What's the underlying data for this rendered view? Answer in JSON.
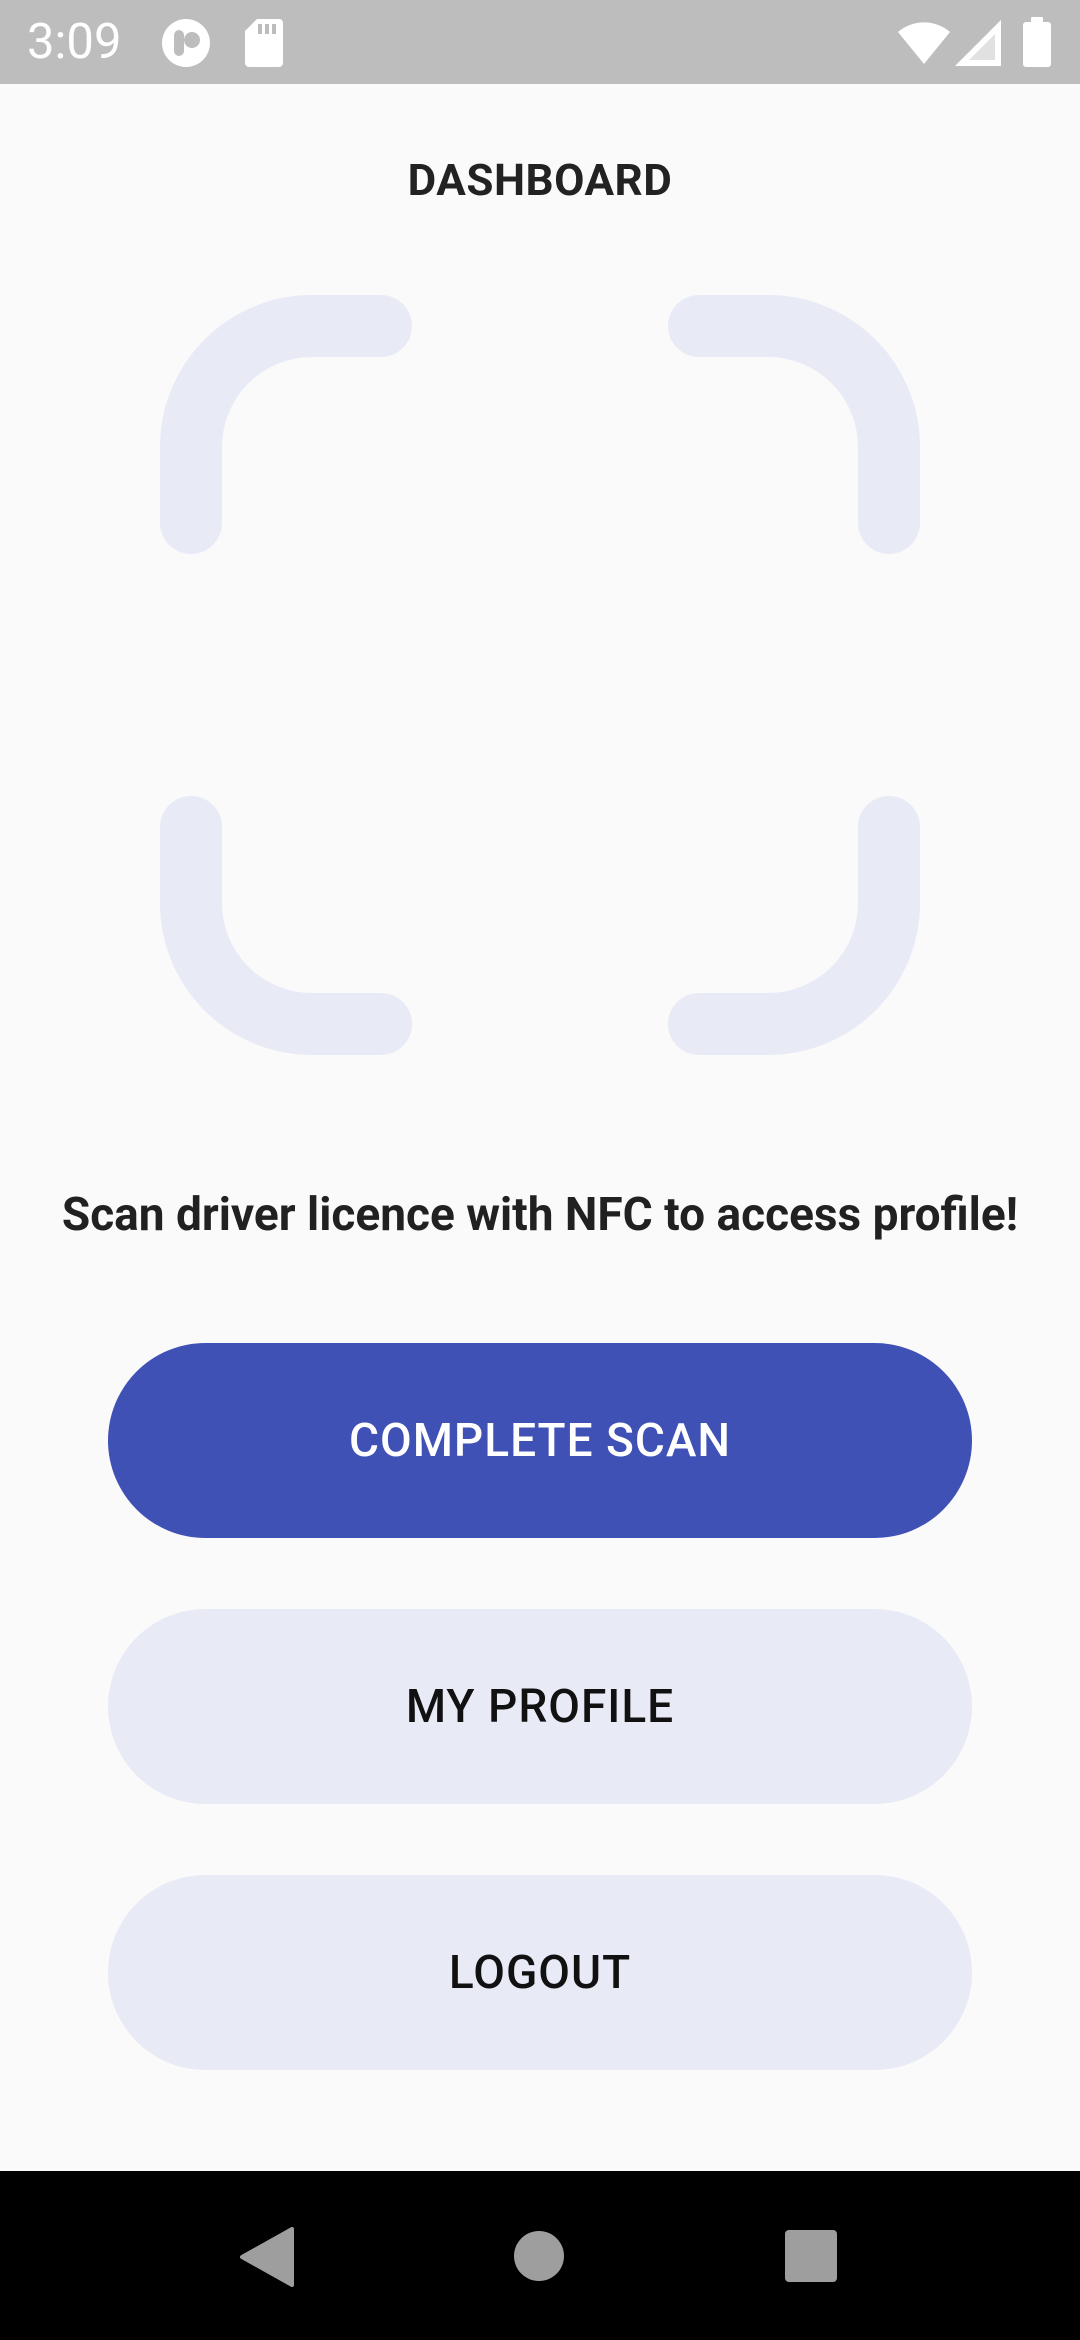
{
  "status_bar": {
    "time": "3:09",
    "icons": [
      "notification-app-icon",
      "sd-card-icon",
      "wifi-icon",
      "cellular-signal-icon",
      "battery-icon"
    ]
  },
  "page": {
    "title": "DASHBOARD",
    "scan_icon": "scan-frame-icon",
    "message": "Scan driver licence with NFC to access profile!"
  },
  "buttons": {
    "complete_scan": "COMPLETE SCAN",
    "my_profile": "MY PROFILE",
    "logout": "LOGOUT"
  },
  "nav_bar": {
    "icons": [
      "back-icon",
      "home-icon",
      "recents-icon"
    ]
  },
  "colors": {
    "primary": "#3f51b5",
    "secondary": "#e8eaf6",
    "status_bar": "#bdbdbd",
    "background": "#fafafa"
  }
}
